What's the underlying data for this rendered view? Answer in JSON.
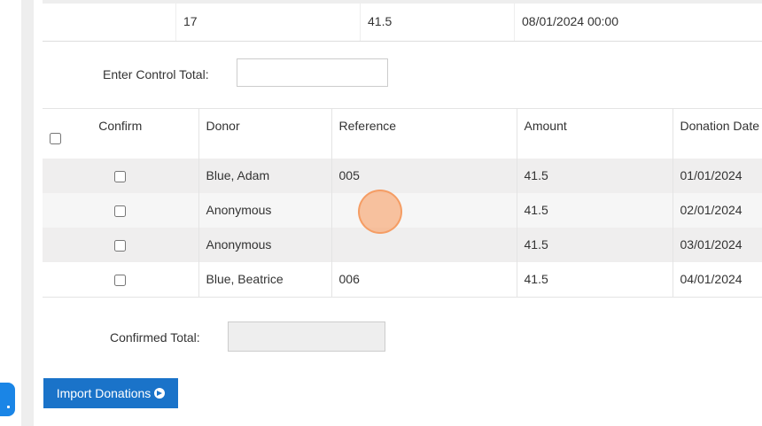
{
  "summary_row": {
    "count": "17",
    "amount": "41.5",
    "date": "08/01/2024 00:00"
  },
  "control_total": {
    "label": "Enter Control Total:",
    "value": ""
  },
  "donations_table": {
    "headers": {
      "confirm": "Confirm",
      "donor": "Donor",
      "reference": "Reference",
      "amount": "Amount",
      "date": "Donation Date"
    },
    "rows": [
      {
        "confirmed": false,
        "donor": "Blue, Adam",
        "reference": "005",
        "amount": "41.5",
        "date": "01/01/2024"
      },
      {
        "confirmed": false,
        "donor": "Anonymous",
        "reference": "",
        "amount": "41.5",
        "date": "02/01/2024"
      },
      {
        "confirmed": false,
        "donor": "Anonymous",
        "reference": "",
        "amount": "41.5",
        "date": "03/01/2024"
      },
      {
        "confirmed": false,
        "donor": "Blue, Beatrice",
        "reference": "006",
        "amount": "41.5",
        "date": "04/01/2024"
      }
    ]
  },
  "confirmed_total": {
    "label": "Confirmed Total:",
    "value": ""
  },
  "import_button": {
    "label": "Import Donations",
    "icon": "arrow-circle-right-icon"
  },
  "colors": {
    "primary": "#1a73c9",
    "row_alt": "#efeeee",
    "click_marker": "#f7a56e"
  }
}
